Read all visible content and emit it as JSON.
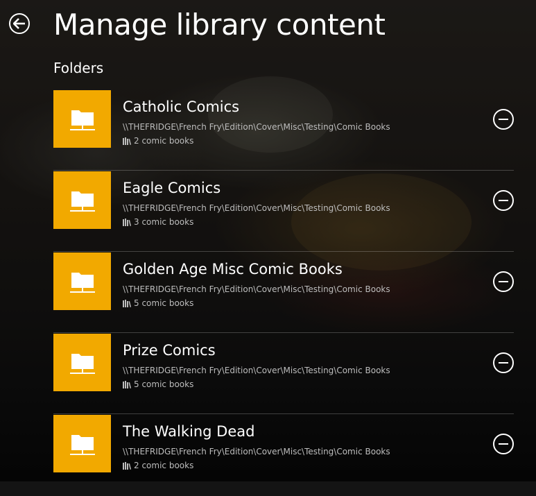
{
  "header": {
    "title": "Manage library content",
    "back_icon": "arrow-left-icon"
  },
  "section": {
    "heading": "Folders"
  },
  "colors": {
    "tile": "#f2a900",
    "text": "#ffffff",
    "secondary_text": "#bdbdbd"
  },
  "folders": [
    {
      "name": "Catholic Comics",
      "path": "\\\\THEFRIDGE\\French Fry\\Edition\\Cover\\Misc\\Testing\\Comic Books",
      "count": "2 comic books"
    },
    {
      "name": "Eagle Comics",
      "path": "\\\\THEFRIDGE\\French Fry\\Edition\\Cover\\Misc\\Testing\\Comic Books",
      "count": "3 comic books"
    },
    {
      "name": "Golden Age Misc Comic Books",
      "path": "\\\\THEFRIDGE\\French Fry\\Edition\\Cover\\Misc\\Testing\\Comic Books",
      "count": "5 comic books"
    },
    {
      "name": "Prize Comics",
      "path": "\\\\THEFRIDGE\\French Fry\\Edition\\Cover\\Misc\\Testing\\Comic Books",
      "count": "5 comic books"
    },
    {
      "name": "The Walking Dead",
      "path": "\\\\THEFRIDGE\\French Fry\\Edition\\Cover\\Misc\\Testing\\Comic Books",
      "count": "2 comic books"
    }
  ],
  "icons": {
    "tile": "network-folder-icon",
    "count": "library-icon",
    "remove": "remove-circle-icon"
  }
}
